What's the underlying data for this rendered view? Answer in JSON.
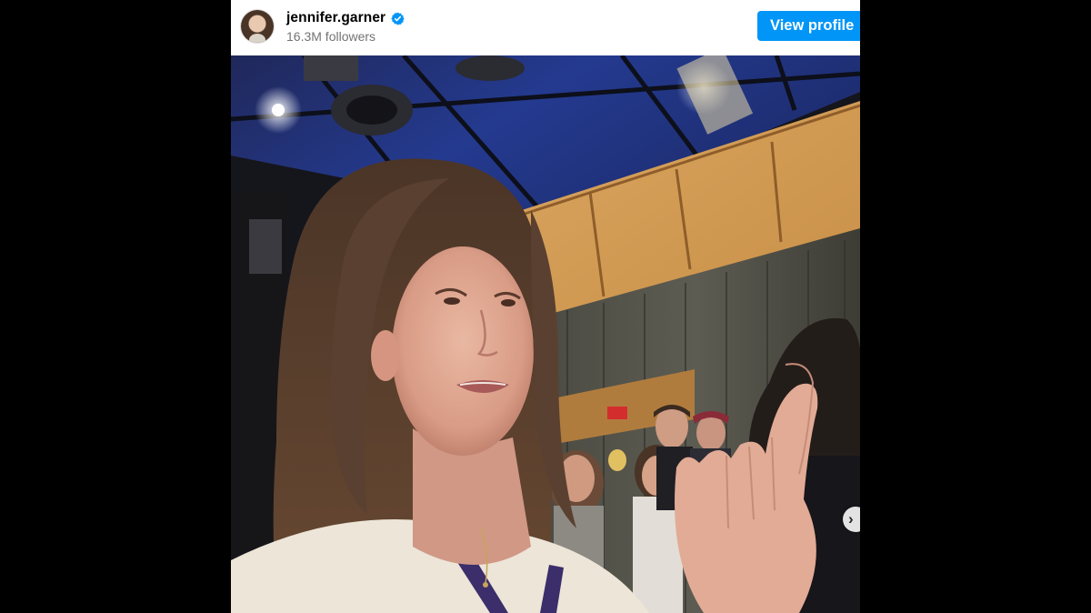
{
  "post_header": {
    "username": "jennifer.garner",
    "verified": true,
    "followers_text": "16.3M followers",
    "view_profile_label": "View profile"
  },
  "media": {
    "type": "photo",
    "alt_visible_text": ""
  },
  "carousel": {
    "next_icon": "chevron-right-icon"
  },
  "colors": {
    "button_blue": "#0095f6",
    "verified_blue": "#0095f6",
    "secondary_text": "#737373",
    "page_background": "#000000"
  }
}
